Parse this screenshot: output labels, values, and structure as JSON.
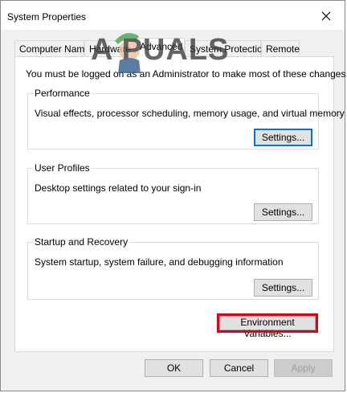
{
  "window": {
    "title": "System Properties",
    "close_icon": "close-icon"
  },
  "tabs": [
    {
      "label": "Computer Name",
      "active": false
    },
    {
      "label": "Hardware",
      "active": false
    },
    {
      "label": "Advanced",
      "active": true
    },
    {
      "label": "System Protection",
      "active": false
    },
    {
      "label": "Remote",
      "active": false
    }
  ],
  "notice": "You must be logged on as an Administrator to make most of these changes.",
  "groups": {
    "performance": {
      "title": "Performance",
      "description": "Visual effects, processor scheduling, memory usage, and virtual memory",
      "button": "Settings..."
    },
    "user_profiles": {
      "title": "User Profiles",
      "description": "Desktop settings related to your sign-in",
      "button": "Settings..."
    },
    "startup_recovery": {
      "title": "Startup and Recovery",
      "description": "System startup, system failure, and debugging information",
      "button": "Settings..."
    }
  },
  "environment_button": "Environment Variables...",
  "footer": {
    "ok": "OK",
    "cancel": "Cancel",
    "apply": "Apply"
  },
  "watermark": {
    "text": "A  PUALS",
    "icon": "mascot-icon"
  },
  "colors": {
    "highlight": "#e0000f",
    "focus": "#0078d7"
  }
}
